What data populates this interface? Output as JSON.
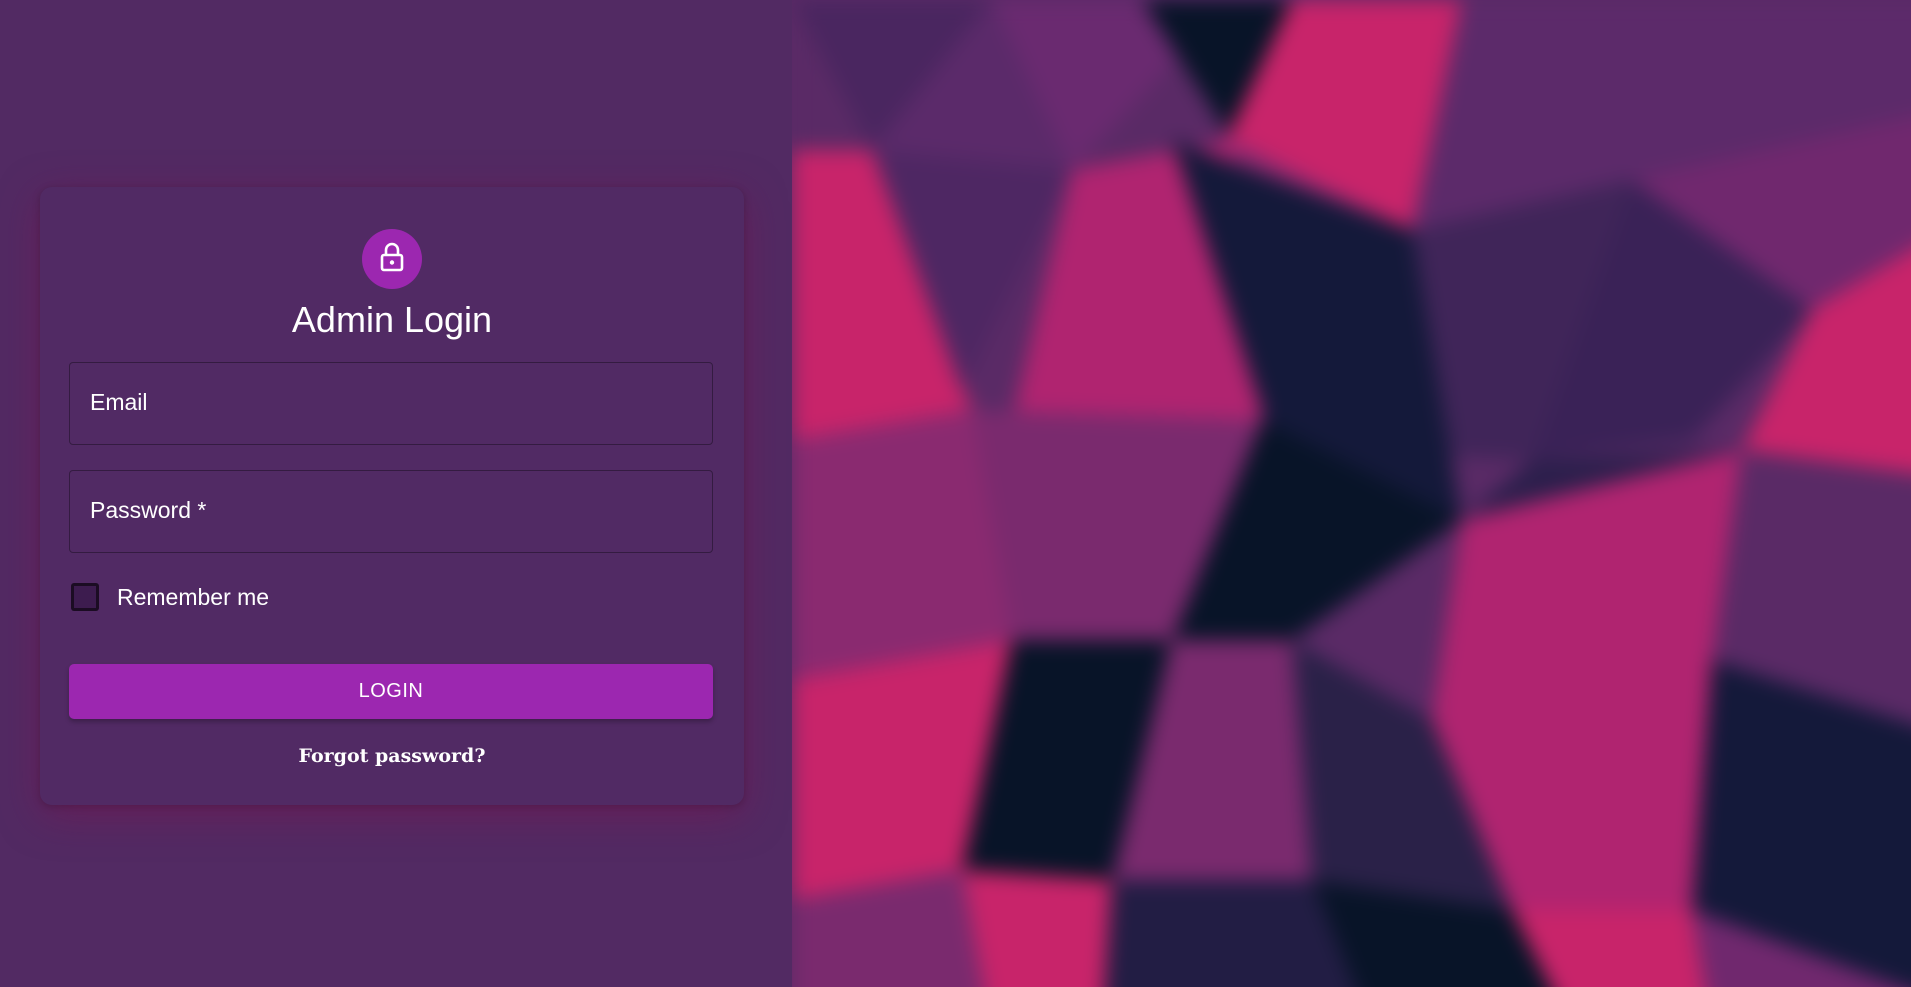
{
  "login_card": {
    "icon": "lock-icon",
    "title": "Admin Login",
    "email_label": "Email",
    "password_label": "Password *",
    "remember_label": "Remember me",
    "remember_checked": false,
    "login_button": "LOGIN",
    "forgot_link": "Forgot password?"
  },
  "colors": {
    "background": "#522a63",
    "accent": "#9c27b0",
    "text": "#ffffff",
    "pattern_pink": "#c8246a",
    "pattern_navy": "#14193a"
  },
  "background_image": "low-poly-triangle-pattern"
}
